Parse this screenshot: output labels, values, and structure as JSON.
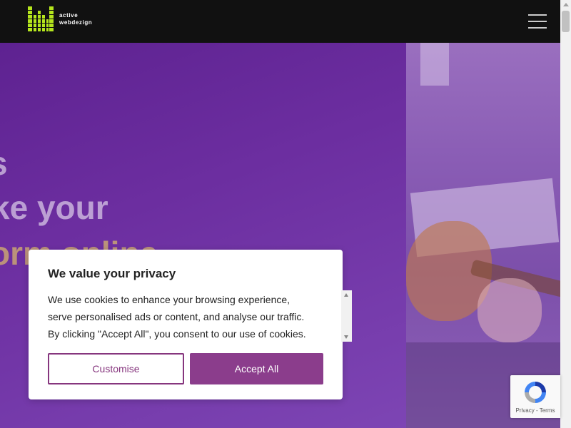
{
  "header": {
    "logo_line1": "active",
    "logo_line2": "webdezign",
    "menu_icon": "hamburger-icon",
    "logo_color": "#b5e61d"
  },
  "hero": {
    "line1": "s",
    "line2": "ke your",
    "line3": "orm online",
    "line3_color": "#d6b46e"
  },
  "cookie": {
    "title": "We value your privacy",
    "text": "We use cookies to enhance your browsing experience, serve personalised ads or content, and analyse our traffic. By clicking \"Accept All\", you consent to our use of cookies.",
    "customise_label": "Customise",
    "accept_label": "Accept All",
    "accent_color": "#8b3d8c"
  },
  "recaptcha": {
    "privacy": "Privacy",
    "separator": " - ",
    "terms": "Terms"
  }
}
